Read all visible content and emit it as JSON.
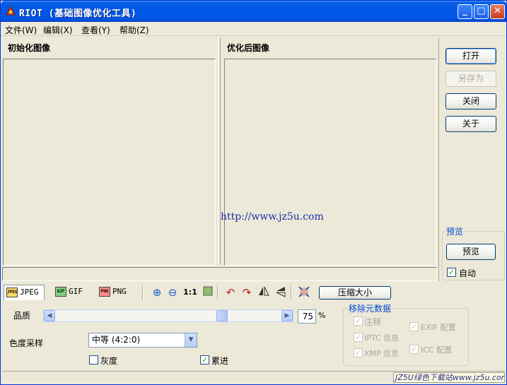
{
  "window": {
    "title": "RIOT (基础图像优化工具)",
    "controls": {
      "minimize": "_",
      "maximize": "□",
      "close": "✕"
    }
  },
  "menu": [
    {
      "label": "文件(W)"
    },
    {
      "label": "编辑(X)"
    },
    {
      "label": "查看(Y)"
    },
    {
      "label": "帮助(Z)"
    }
  ],
  "panels": {
    "original_label": "初始化图像",
    "optimized_label": "优化后图像"
  },
  "watermark_url": "http://www.jz5u.com",
  "side_buttons": {
    "open": "打开",
    "save_as": "另存为",
    "close": "关闭",
    "about": "关于"
  },
  "preview": {
    "group_title": "预览",
    "button": "预览",
    "auto_label": "自动",
    "auto_checked": true
  },
  "format_tabs": [
    {
      "label": "JPEG",
      "icon": "JPEG",
      "active": true
    },
    {
      "label": "GIF",
      "icon": "GIF",
      "active": false
    },
    {
      "label": "PNG",
      "icon": "PNG",
      "active": false
    }
  ],
  "toolbar": {
    "actual_size": "1:1",
    "compress_button": "压缩大小"
  },
  "quality": {
    "label": "品质",
    "value": "75",
    "unit": "%",
    "fraction": 0.75
  },
  "chroma": {
    "label": "色度采样",
    "selected": "中等 (4:2:0)"
  },
  "options": {
    "grayscale_label": "灰度",
    "grayscale_checked": false,
    "progressive_label": "累进",
    "progressive_checked": true
  },
  "metadata": {
    "group_title": "移除元数据",
    "comments": "注释",
    "exif": "EXIF 配置",
    "iptc": "IPTC 信息",
    "xmp": "XMP 信息",
    "icc": "ICC 配置"
  },
  "badge_text": "JZ5U绿色下载站www.jz5u.com",
  "colors": {
    "titlebar": "#0054e3",
    "group_title": "#0046d5",
    "watermark": "#1a2fa8"
  }
}
